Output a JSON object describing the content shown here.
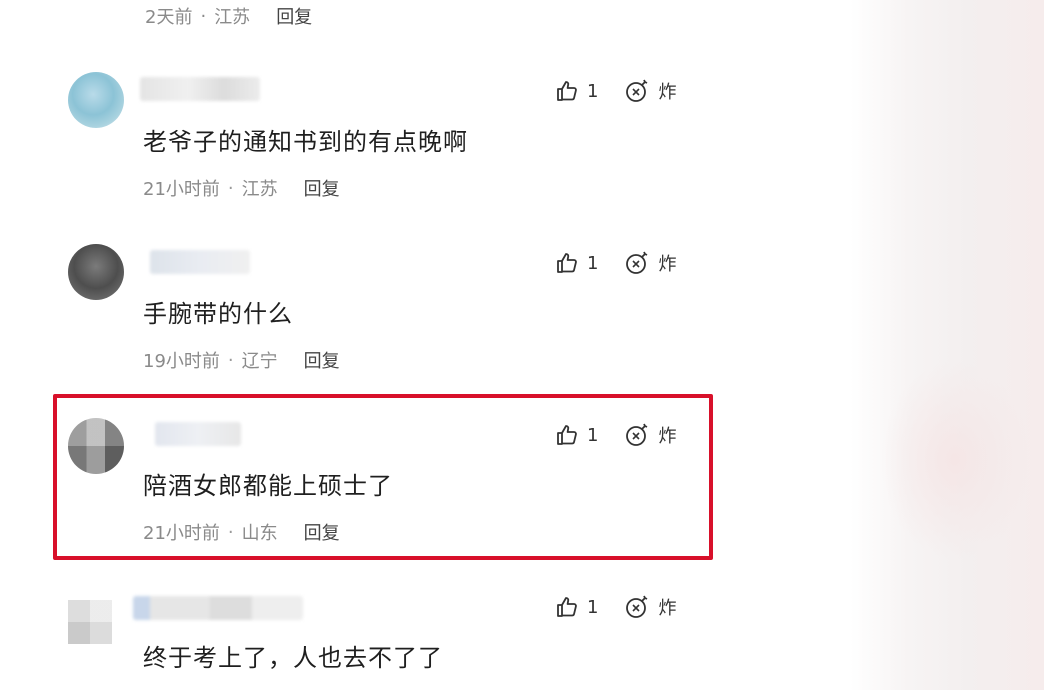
{
  "top_stub": {
    "time": "2天前",
    "separator": "·",
    "location": "江苏",
    "reply": "回复"
  },
  "comments": [
    {
      "likes": "1",
      "bomb_label": "炸",
      "text": "老爷子的通知书到的有点晚啊",
      "time": "21小时前",
      "separator": "·",
      "location": "江苏",
      "reply": "回复"
    },
    {
      "likes": "1",
      "bomb_label": "炸",
      "text": "手腕带的什么",
      "time": "19小时前",
      "separator": "·",
      "location": "辽宁",
      "reply": "回复"
    },
    {
      "likes": "1",
      "bomb_label": "炸",
      "text": "陪酒女郎都能上硕士了",
      "time": "21小时前",
      "separator": "·",
      "location": "山东",
      "reply": "回复"
    },
    {
      "likes": "1",
      "bomb_label": "炸",
      "text": "终于考上了，人也去不了了"
    }
  ],
  "icons": {
    "like": "thumbs-up-icon",
    "bomb": "bomb-icon"
  },
  "colors": {
    "highlight_border": "#d8102a",
    "meta_text": "#8a8a8a",
    "body_text": "#1f1f1f"
  }
}
